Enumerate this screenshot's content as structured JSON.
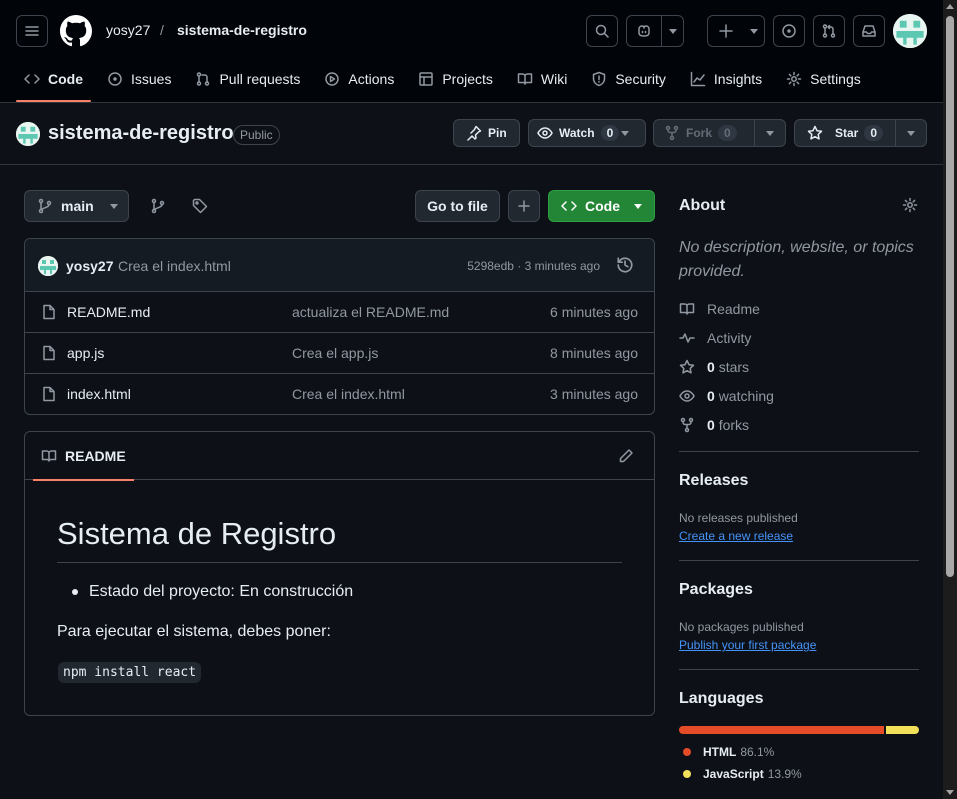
{
  "colors": {
    "background": "#0d1117",
    "header_bg": "#010409",
    "border": "#3d444d",
    "text": "#e6edf3",
    "muted": "#9198a1",
    "accent_underline": "#f78166",
    "code_button": "#238636",
    "link": "#4493f8"
  },
  "header": {
    "owner": "yosy27",
    "separator": "/",
    "repo": "sistema-de-registro",
    "icons": [
      "menu-icon",
      "github-logo-icon",
      "search-icon",
      "copilot-icon",
      "plus-icon",
      "issue-icon",
      "pull-request-icon",
      "inbox-icon"
    ]
  },
  "tabs": [
    {
      "label": "Code",
      "icon": "code-icon",
      "active": true
    },
    {
      "label": "Issues",
      "icon": "issue-icon"
    },
    {
      "label": "Pull requests",
      "icon": "pull-request-icon"
    },
    {
      "label": "Actions",
      "icon": "play-icon"
    },
    {
      "label": "Projects",
      "icon": "table-icon"
    },
    {
      "label": "Wiki",
      "icon": "book-icon"
    },
    {
      "label": "Security",
      "icon": "shield-icon"
    },
    {
      "label": "Insights",
      "icon": "graph-icon"
    },
    {
      "label": "Settings",
      "icon": "gear-icon"
    }
  ],
  "repo": {
    "name": "sistema-de-registro",
    "visibility": "Public",
    "pin_label": "Pin",
    "watch_label": "Watch",
    "watch_count": "0",
    "fork_label": "Fork",
    "fork_count": "0",
    "star_label": "Star",
    "star_count": "0"
  },
  "toolbar": {
    "branch": "main",
    "go_to_file": "Go to file",
    "code_label": "Code"
  },
  "commit": {
    "user": "yosy27",
    "message": "Crea el index.html",
    "meta": "5298edb · 3 minutes ago"
  },
  "files": [
    {
      "name": "README.md",
      "message": "actualiza el README.md",
      "time": "6 minutes ago"
    },
    {
      "name": "app.js",
      "message": "Crea el app.js",
      "time": "8 minutes ago"
    },
    {
      "name": "index.html",
      "message": "Crea el index.html",
      "time": "3 minutes ago"
    }
  ],
  "readme": {
    "tab_label": "README",
    "h1": "Sistema de Registro",
    "list_item": "Estado del proyecto: En construcción",
    "paragraph": "Para ejecutar el sistema, debes poner:",
    "code": "npm install react"
  },
  "about": {
    "title": "About",
    "description": "No description, website, or topics provided.",
    "readme": "Readme",
    "activity": "Activity",
    "stars_count": "0",
    "stars_label": "stars",
    "watching_count": "0",
    "watching_label": "watching",
    "forks_count": "0",
    "forks_label": "forks"
  },
  "releases": {
    "title": "Releases",
    "empty": "No releases published",
    "link": "Create a new release"
  },
  "packages": {
    "title": "Packages",
    "empty": "No packages published",
    "link": "Publish your first package"
  },
  "languages": {
    "title": "Languages",
    "items": [
      {
        "name": "HTML",
        "percent": "86.1%",
        "value": 86.1,
        "color": "#e34c26"
      },
      {
        "name": "JavaScript",
        "percent": "13.9%",
        "value": 13.9,
        "color": "#f1e05a"
      }
    ]
  }
}
